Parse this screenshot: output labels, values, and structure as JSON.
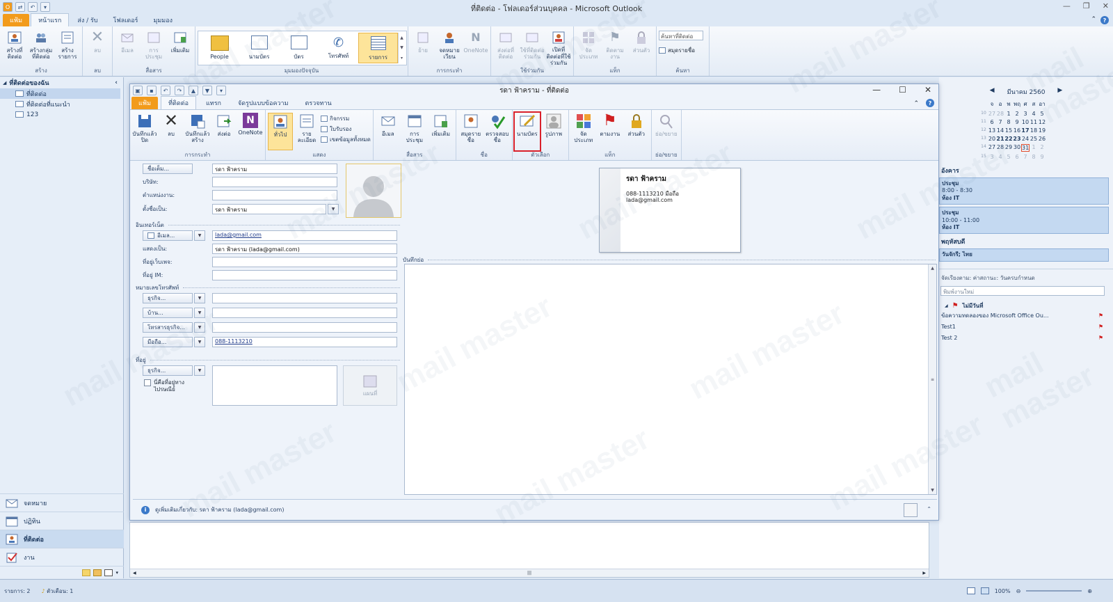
{
  "app": {
    "title": "ที่ติดต่อ - โฟลเดอร์ส่วนบุคคล - Microsoft Outlook",
    "tabs": [
      "แฟ้ม",
      "หน้าแรก",
      "ส่ง / รับ",
      "โฟลเดอร์",
      "มุมมอง"
    ],
    "ribbon": {
      "new": {
        "label": "สร้าง",
        "buttons": [
          "สร้างที่ติดต่อ",
          "สร้างกลุ่มที่ติดต่อ",
          "สร้างรายการ"
        ]
      },
      "delete": {
        "label": "ลบ",
        "buttons": [
          "ลบ"
        ]
      },
      "communicate": {
        "label": "สื่อสาร",
        "buttons": [
          "อีเมล",
          "การประชุม",
          "เพิ่มเติม"
        ]
      },
      "current_view": {
        "label": "มุมมองปัจจุบัน",
        "items": [
          "People",
          "นามบัตร",
          "บัตร",
          "โทรศัพท์",
          "รายการ"
        ]
      },
      "actions": {
        "label": "การกระทำ",
        "buttons": [
          "ย้าย",
          "จดหมายเวียน",
          "OneNote"
        ]
      },
      "share": {
        "label": "ใช้ร่วมกัน",
        "buttons": [
          "ส่งต่อที่ติดต่อ",
          "ใช้ที่ติดต่อร่วมกัน",
          "เปิดที่ติดต่อที่ใช้ร่วมกัน"
        ]
      },
      "tags": {
        "label": "แท็ก",
        "buttons": [
          "จัดประเภท",
          "ติดตามงาน",
          "ส่วนตัว"
        ]
      },
      "find": {
        "label": "ค้นหา",
        "placeholder": "ค้นหาที่ติดต่อ",
        "address_book": "สมุดรายชื่อ"
      }
    }
  },
  "leftnav": {
    "header": "ที่ติดต่อของฉัน",
    "items": [
      "ที่ติดต่อ",
      "ที่ติดต่อที่แนะนำ",
      "123"
    ],
    "buttons": [
      "จดหมาย",
      "ปฏิทิน",
      "ที่ติดต่อ",
      "งาน"
    ]
  },
  "todo": {
    "month": "มีนาคม 2560",
    "weekdays": [
      "จ",
      "อ",
      "พ",
      "พฤ",
      "ศ",
      "ส",
      "อา"
    ],
    "weeks": [
      {
        "wk": "10",
        "days": [
          "27",
          "28",
          "1",
          "2",
          "3",
          "4",
          "5"
        ]
      },
      {
        "wk": "11",
        "days": [
          "6",
          "7",
          "8",
          "9",
          "10",
          "11",
          "12"
        ]
      },
      {
        "wk": "12",
        "days": [
          "13",
          "14",
          "15",
          "16",
          "17",
          "18",
          "19"
        ]
      },
      {
        "wk": "13",
        "days": [
          "20",
          "21",
          "22",
          "23",
          "24",
          "25",
          "26"
        ]
      },
      {
        "wk": "14",
        "days": [
          "27",
          "28",
          "29",
          "30",
          "31",
          "1",
          "2"
        ]
      },
      {
        "wk": "15",
        "days": [
          "3",
          "4",
          "5",
          "6",
          "7",
          "8",
          "9"
        ]
      }
    ],
    "sections": [
      {
        "day": "อังคาร",
        "appts": [
          {
            "title": "ประชุม",
            "time": "8:00 - 8:30",
            "place": "ห้อง IT"
          },
          {
            "title": "ประชุม",
            "time": "10:00 - 11:00",
            "place": "ห้อง IT"
          }
        ]
      },
      {
        "day": "พฤหัสบดี",
        "appts": [
          {
            "title": "วันจักรี; ไทย",
            "time": "",
            "place": ""
          }
        ]
      }
    ],
    "task_header": "จัดเรียงตาม: ค่าสถานะ: วันครบกำหนด",
    "task_placeholder": "พิมพ์งานใหม่",
    "task_group": "ไม่มีวันที่",
    "tasks": [
      "ข้อความทดลองของ Microsoft Office Ou...",
      "Test1",
      "Test 2"
    ]
  },
  "status": {
    "items": "รายการ: 2",
    "reminders": "ตัวเตือน: 1",
    "zoom": "100%"
  },
  "contact_window": {
    "title": "รดา ฟ้าคราม - ที่ติดต่อ",
    "tabs": [
      "แฟ้ม",
      "ที่ติดต่อ",
      "แทรก",
      "จัดรูปแบบข้อความ",
      "ตรวจทาน"
    ],
    "ribbon": {
      "actions": {
        "label": "การกระทำ",
        "buttons": [
          "บันทึกแล้วปิด",
          "ลบ",
          "บันทึกแล้วสร้าง",
          "ส่งต่อ",
          "OneNote"
        ]
      },
      "show": {
        "label": "แสดง",
        "buttons": [
          "ทั่วไป",
          "รายละเอียด"
        ],
        "small": [
          "กิจกรรม",
          "ใบรับรอง",
          "เขตข้อมูลทั้งหมด"
        ]
      },
      "communicate": {
        "label": "สื่อสาร",
        "buttons": [
          "อีเมล",
          "การประชุม",
          "เพิ่มเติม"
        ]
      },
      "names": {
        "label": "ชื่อ",
        "buttons": [
          "สมุดรายชื่อ",
          "ตรวจสอบชื่อ"
        ]
      },
      "options": {
        "label": "ตัวเลือก",
        "buttons": [
          "นามบัตร",
          "รูปภาพ"
        ]
      },
      "tags": {
        "label": "แท็ก",
        "buttons": [
          "จัดประเภท",
          "ตามงาน",
          "ส่วนตัว"
        ]
      },
      "zoom": {
        "label": "ย่อ/ขยาย",
        "buttons": [
          "ย่อ/ขยาย"
        ]
      }
    },
    "form": {
      "full_name_btn": "ชื่อเต็ม...",
      "full_name": "รดา ฟ้าคราม",
      "company_label": "บริษัท:",
      "company": "",
      "job_title_label": "ตำแหน่งงาน:",
      "job_title": "",
      "file_as_label": "ตั้งชื่อเป็น:",
      "file_as": "รดา ฟ้าคราม",
      "internet_label": "อินเทอร์เน็ต",
      "email_btn": "อีเมล...",
      "email": "lada@gmail.com",
      "display_as_label": "แสดงเป็น:",
      "display_as": "รดา ฟ้าคราม (lada@gmail.com)",
      "web_label": "ที่อยู่เว็บเพจ:",
      "web": "",
      "im_label": "ที่อยู่ IM:",
      "im": "",
      "phone_label": "หมายเลขโทรศัพท์",
      "phone_btns": [
        "ธุรกิจ...",
        "บ้าน...",
        "โทรสารธุรกิจ...",
        "มือถือ..."
      ],
      "phone_vals": [
        "",
        "",
        "",
        "088-1113210"
      ],
      "address_label": "ที่อยู่",
      "address_btn": "ธุรกิจ...",
      "mailing_chk": "นี่คือที่อยู่ทางไปรษณีย์",
      "map_btn": "แผนที่"
    },
    "card": {
      "name": "รดา ฟ้าคราม",
      "line1": "088-1113210 มือถือ",
      "line2": "lada@gmail.com"
    },
    "notes_label": "บันทึกย่อ",
    "info": "ดูเพิ่มเติมเกี่ยวกับ: รดา ฟ้าคราม (lada@gmail.com)"
  },
  "watermark": "mail master"
}
